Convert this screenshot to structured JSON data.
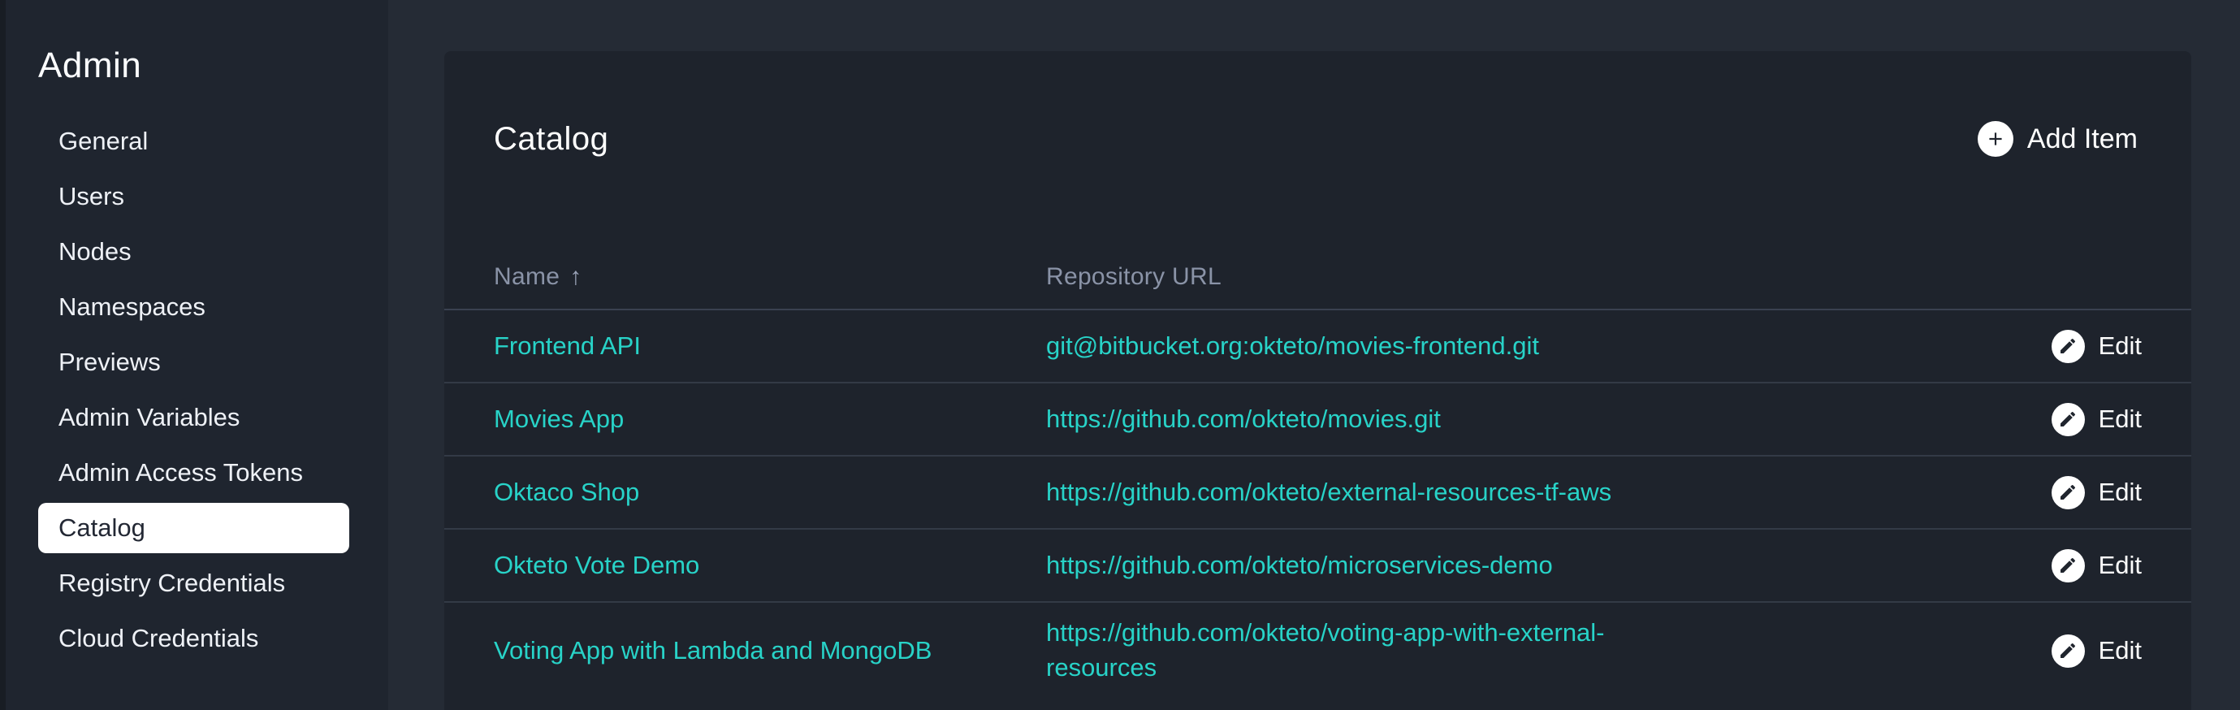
{
  "colors": {
    "accent_teal": "#28d3c8",
    "outer_bg": "#252b35",
    "sidebar_bg": "#1f252f",
    "panel_bg": "#1e232c",
    "selected_item_bg": "#ffffff",
    "selected_item_text": "#232834",
    "muted_header_text": "#8a93a7"
  },
  "sidebar": {
    "title": "Admin",
    "items": [
      {
        "label": "General",
        "selected": false
      },
      {
        "label": "Users",
        "selected": false
      },
      {
        "label": "Nodes",
        "selected": false
      },
      {
        "label": "Namespaces",
        "selected": false
      },
      {
        "label": "Previews",
        "selected": false
      },
      {
        "label": "Admin Variables",
        "selected": false
      },
      {
        "label": "Admin Access Tokens",
        "selected": false
      },
      {
        "label": "Catalog",
        "selected": true
      },
      {
        "label": "Registry Credentials",
        "selected": false
      },
      {
        "label": "Cloud Credentials",
        "selected": false
      }
    ]
  },
  "main": {
    "panel_title": "Catalog",
    "add_item_button": {
      "label": "Add Item",
      "icon": "plus-icon"
    },
    "table": {
      "columns": [
        {
          "label": "Name",
          "sort": "ascending",
          "sort_icon": "↑"
        },
        {
          "label": "Repository URL"
        },
        {
          "label": ""
        }
      ],
      "rows": [
        {
          "name": "Frontend API",
          "repository_url": "git@bitbucket.org:okteto/movies-frontend.git",
          "action": "Edit"
        },
        {
          "name": "Movies App",
          "repository_url": "https://github.com/okteto/movies.git",
          "action": "Edit"
        },
        {
          "name": "Oktaco Shop",
          "repository_url": "https://github.com/okteto/external-resources-tf-aws",
          "action": "Edit"
        },
        {
          "name": "Okteto Vote Demo",
          "repository_url": "https://github.com/okteto/microservices-demo",
          "action": "Edit"
        },
        {
          "name": "Voting App with Lambda and MongoDB",
          "repository_url": "https://github.com/okteto/voting-app-with-external-resources",
          "action": "Edit"
        }
      ]
    }
  }
}
